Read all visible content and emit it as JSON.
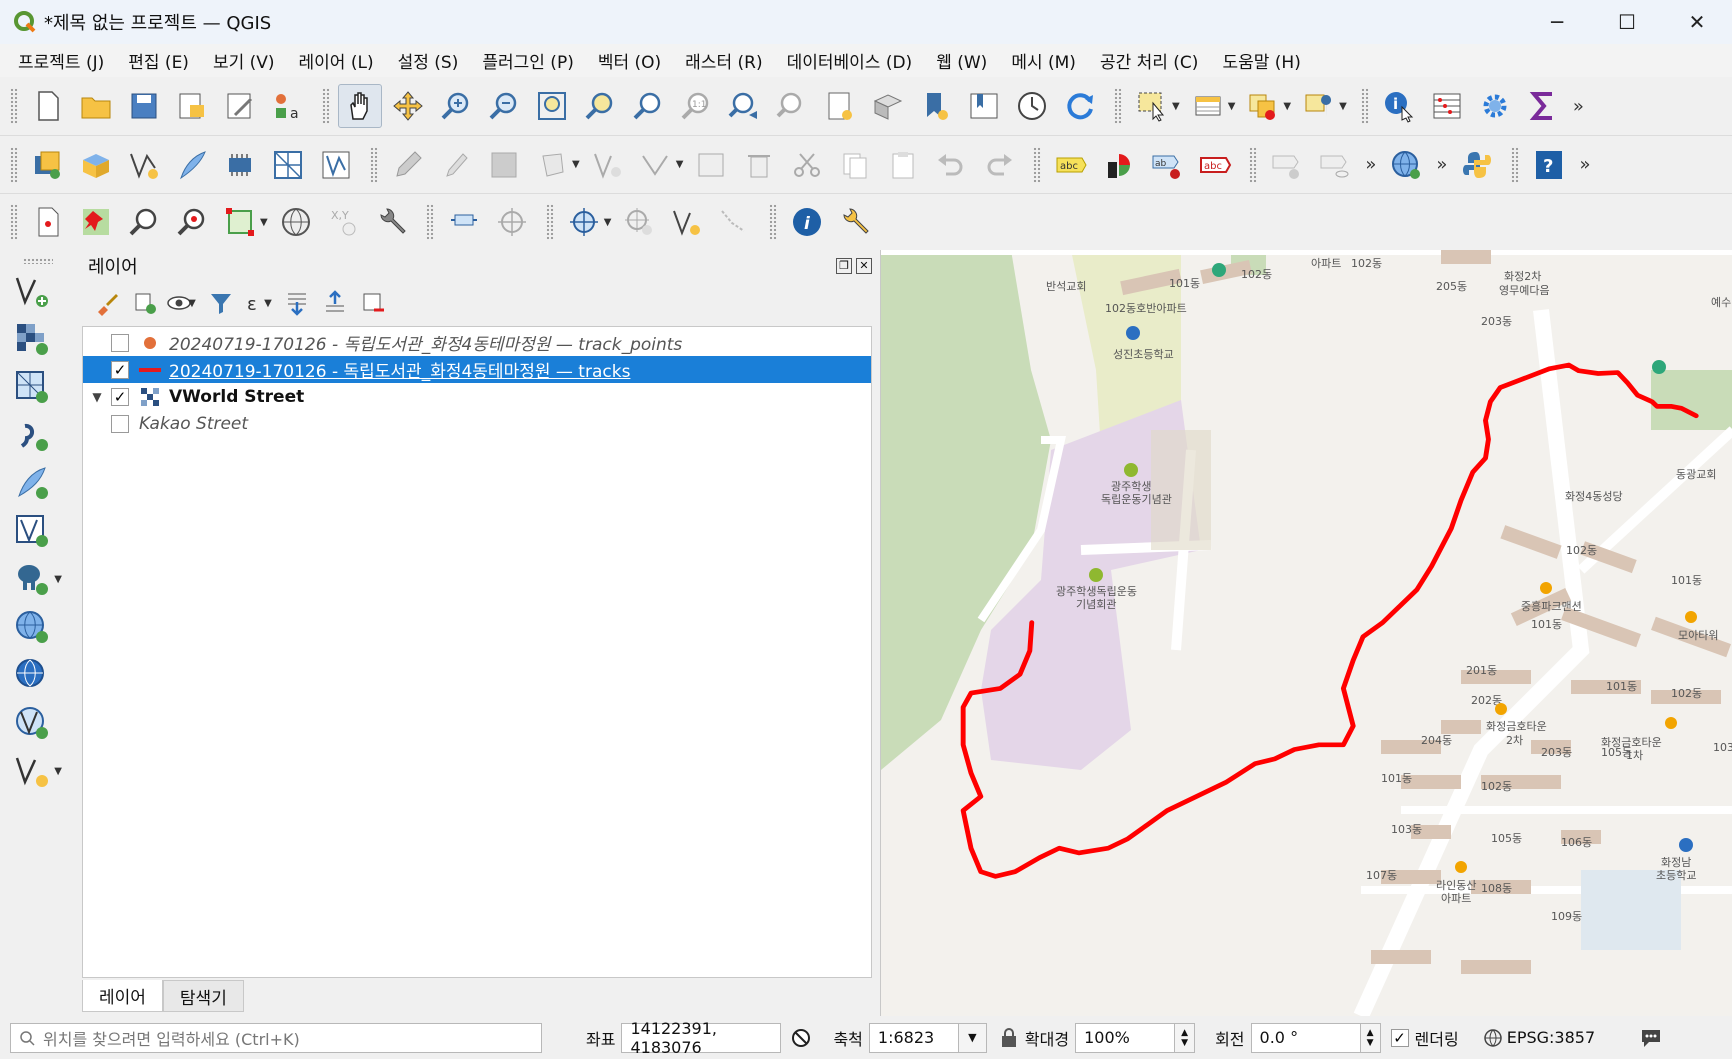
{
  "window": {
    "title": "*제목 없는 프로젝트 — QGIS",
    "minimize": "─",
    "maximize": "☐",
    "close": "✕"
  },
  "menu": [
    "프로젝트 (J)",
    "편집 (E)",
    "보기 (V)",
    "레이어 (L)",
    "설정 (S)",
    "플러그인 (P)",
    "벡터 (O)",
    "래스터 (R)",
    "데이터베이스 (D)",
    "웹 (W)",
    "메시 (M)",
    "공간 처리 (C)",
    "도움말 (H)"
  ],
  "layers_panel": {
    "title": "레이어",
    "layers": [
      {
        "name": "20240719-170126 - 독립도서관_화정4동테마정원 — track_points",
        "checked": false,
        "symbol": "point",
        "color": "#e2703a"
      },
      {
        "name": "20240719-170126 - 독립도서관_화정4동테마정원 — tracks",
        "checked": true,
        "symbol": "line",
        "color": "#e31a1c"
      },
      {
        "name": "VWorld Street",
        "checked": true,
        "symbol": "raster"
      },
      {
        "name": "Kakao Street",
        "checked": false,
        "symbol": "none"
      }
    ],
    "check_mark": "✓",
    "tabs": [
      "레이어",
      "탐색기"
    ]
  },
  "map": {
    "track_color": "#ff0000",
    "labels": [
      "반석교회",
      "102동",
      "101동",
      "102동",
      "아파트",
      "205동",
      "화정2차",
      "영무예다음",
      "203동",
      "예수",
      "102동호반아파트",
      "성진초등학교",
      "광주학생",
      "독립운동기념관",
      "동광교회",
      "화정4동성당",
      "102동",
      "101동",
      "광주학생독립운동",
      "기념회관",
      "중흥파크맨션",
      "101동",
      "모아타워",
      "201동",
      "101동",
      "102동",
      "202동",
      "화정금호타운",
      "2차",
      "화정금호타운",
      "1차",
      "204동",
      "203동",
      "105동",
      "103",
      "101동",
      "102동",
      "103동",
      "105동",
      "106동",
      "화정남",
      "초등학교",
      "107동",
      "라인동산",
      "아파트",
      "108동",
      "109동"
    ]
  },
  "statusbar": {
    "locator_placeholder": "위치를 찾으려면 입력하세요 (Ctrl+K)",
    "coord_label": "좌표",
    "coord_value": "14122391, 4183076",
    "scale_label": "축척",
    "scale_value": "1:6823",
    "magnifier_label": "확대경",
    "magnifier_value": "100%",
    "rotation_label": "회전",
    "rotation_value": "0.0 °",
    "render_label": "렌더링",
    "render_checked": "✓",
    "crs": "EPSG:3857"
  }
}
